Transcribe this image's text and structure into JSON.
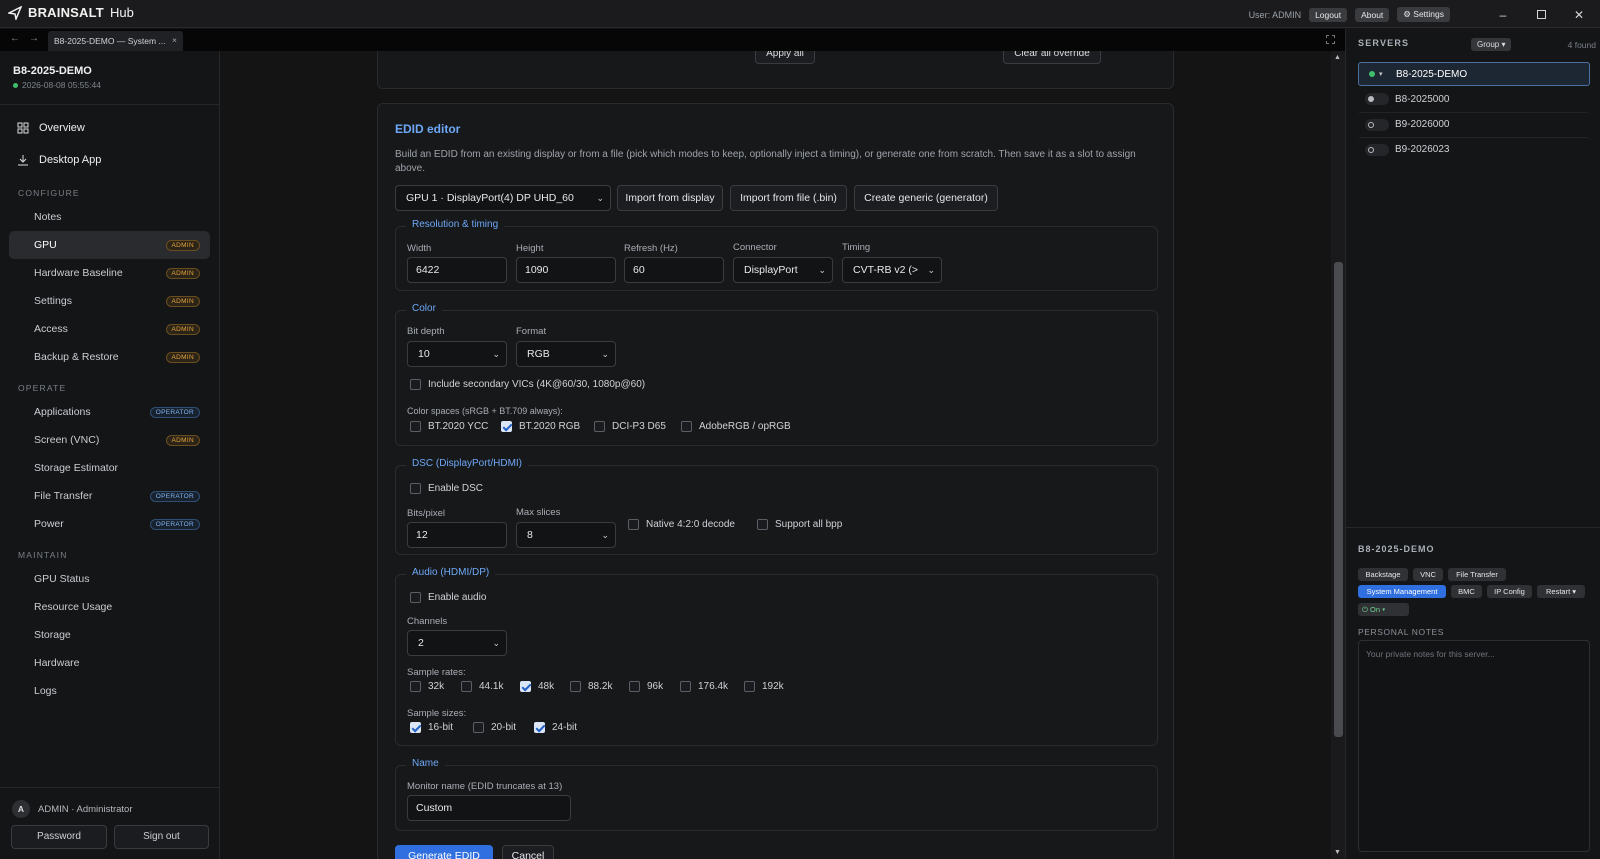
{
  "app": {
    "brand": "BRAINSALT",
    "product": "Hub"
  },
  "topbar": {
    "user": "User: ADMIN",
    "logout": "Logout",
    "about": "About",
    "settings": "⚙ Settings"
  },
  "tab": {
    "title": "B8-2025-DEMO — System ..."
  },
  "server": {
    "name": "B8-2025-DEMO",
    "timestamp": "2026-08-08 05:55:44"
  },
  "nav": {
    "overview": "Overview",
    "desktop_app": "Desktop App",
    "configure_header": "CONFIGURE",
    "configure": [
      {
        "label": "Notes",
        "badge": ""
      },
      {
        "label": "GPU",
        "badge": "ADMIN"
      },
      {
        "label": "Hardware Baseline",
        "badge": "ADMIN"
      },
      {
        "label": "Settings",
        "badge": "ADMIN"
      },
      {
        "label": "Access",
        "badge": "ADMIN"
      },
      {
        "label": "Backup & Restore",
        "badge": "ADMIN"
      }
    ],
    "operate_header": "OPERATE",
    "operate": [
      {
        "label": "Applications",
        "badge": "OPERATOR"
      },
      {
        "label": "Screen (VNC)",
        "badge": "ADMIN"
      },
      {
        "label": "Storage Estimator",
        "badge": ""
      },
      {
        "label": "File Transfer",
        "badge": "OPERATOR"
      },
      {
        "label": "Power",
        "badge": "OPERATOR"
      }
    ],
    "maintain_header": "MAINTAIN",
    "maintain": [
      {
        "label": "GPU Status"
      },
      {
        "label": "Resource Usage"
      },
      {
        "label": "Storage"
      },
      {
        "label": "Hardware"
      },
      {
        "label": "Logs"
      }
    ]
  },
  "sidefoot": {
    "avatar": "A",
    "user": "ADMIN · Administrator",
    "password": "Password",
    "signout": "Sign out"
  },
  "top_card": {
    "apply_all": "Apply all",
    "clear_all": "Clear all override"
  },
  "edid": {
    "title": "EDID editor",
    "description": "Build an EDID from an existing display or from a file (pick which modes to keep, optionally inject a timing), or generate one from scratch. Then save it as a slot to assign above.",
    "source_select": "GPU 1 · DisplayPort(4) DP UHD_60",
    "import_display": "Import from display",
    "import_file": "Import from file (.bin)",
    "create_generic": "Create generic (generator)",
    "resolution": {
      "legend": "Resolution & timing",
      "width_label": "Width",
      "width": "6422",
      "height_label": "Height",
      "height": "1090",
      "refresh_label": "Refresh (Hz)",
      "refresh": "60",
      "connector_label": "Connector",
      "connector": "DisplayPort",
      "timing_label": "Timing",
      "timing": "CVT-RB v2 (>"
    },
    "color": {
      "legend": "Color",
      "bitdepth_label": "Bit depth",
      "bitdepth": "10",
      "format_label": "Format",
      "format": "RGB",
      "secondary_vics": "Include secondary VICs (4K@60/30, 1080p@60)",
      "secondary_vics_checked": false,
      "spaces_label": "Color spaces (sRGB + BT.709 always):",
      "spaces": [
        {
          "label": "BT.2020 YCC",
          "checked": false
        },
        {
          "label": "BT.2020 RGB",
          "checked": true
        },
        {
          "label": "DCI-P3 D65",
          "checked": false
        },
        {
          "label": "AdobeRGB / opRGB",
          "checked": false
        }
      ]
    },
    "dsc": {
      "legend": "DSC (DisplayPort/HDMI)",
      "enable": "Enable DSC",
      "enable_checked": false,
      "bpp_label": "Bits/pixel",
      "bpp": "12",
      "slices_label": "Max slices",
      "slices": "8",
      "native420": "Native 4:2:0 decode",
      "native420_checked": false,
      "allbpp": "Support all bpp",
      "allbpp_checked": false
    },
    "audio": {
      "legend": "Audio (HDMI/DP)",
      "enable": "Enable audio",
      "enable_checked": false,
      "channels_label": "Channels",
      "channels": "2",
      "rates_label": "Sample rates:",
      "rates": [
        {
          "label": "32k",
          "checked": false
        },
        {
          "label": "44.1k",
          "checked": false
        },
        {
          "label": "48k",
          "checked": true
        },
        {
          "label": "88.2k",
          "checked": false
        },
        {
          "label": "96k",
          "checked": false
        },
        {
          "label": "176.4k",
          "checked": false
        },
        {
          "label": "192k",
          "checked": false
        }
      ],
      "sizes_label": "Sample sizes:",
      "sizes": [
        {
          "label": "16-bit",
          "checked": true
        },
        {
          "label": "20-bit",
          "checked": false
        },
        {
          "label": "24-bit",
          "checked": true
        }
      ]
    },
    "name": {
      "legend": "Name",
      "monitor_label": "Monitor name (EDID truncates at 13)",
      "monitor": "Custom"
    },
    "generate": "Generate EDID",
    "cancel": "Cancel"
  },
  "servers": {
    "title": "SERVERS",
    "group": "Group ▾",
    "count": "4 found",
    "items": [
      {
        "name": "B8-2025-DEMO",
        "status": "online",
        "selected": true
      },
      {
        "name": "B8-2025000",
        "status": "idle",
        "selected": false
      },
      {
        "name": "B9-2026000",
        "status": "offline",
        "selected": false
      },
      {
        "name": "B9-2026023",
        "status": "offline",
        "selected": false
      }
    ]
  },
  "detail": {
    "title": "B8-2025-DEMO",
    "chips": [
      "Backstage",
      "VNC",
      "File Transfer",
      "System Management",
      "BMC",
      "IP Config",
      "Restart ▾",
      "⏻ On ▾"
    ],
    "notes_label": "PERSONAL NOTES",
    "notes_placeholder": "Your private notes for this server..."
  },
  "colors": {
    "accent": "#2f6fe0",
    "link": "#6ea8f7",
    "admin_badge": "#e5a43a",
    "operator_badge": "#7fb4f0",
    "online": "#3fbf6b"
  }
}
